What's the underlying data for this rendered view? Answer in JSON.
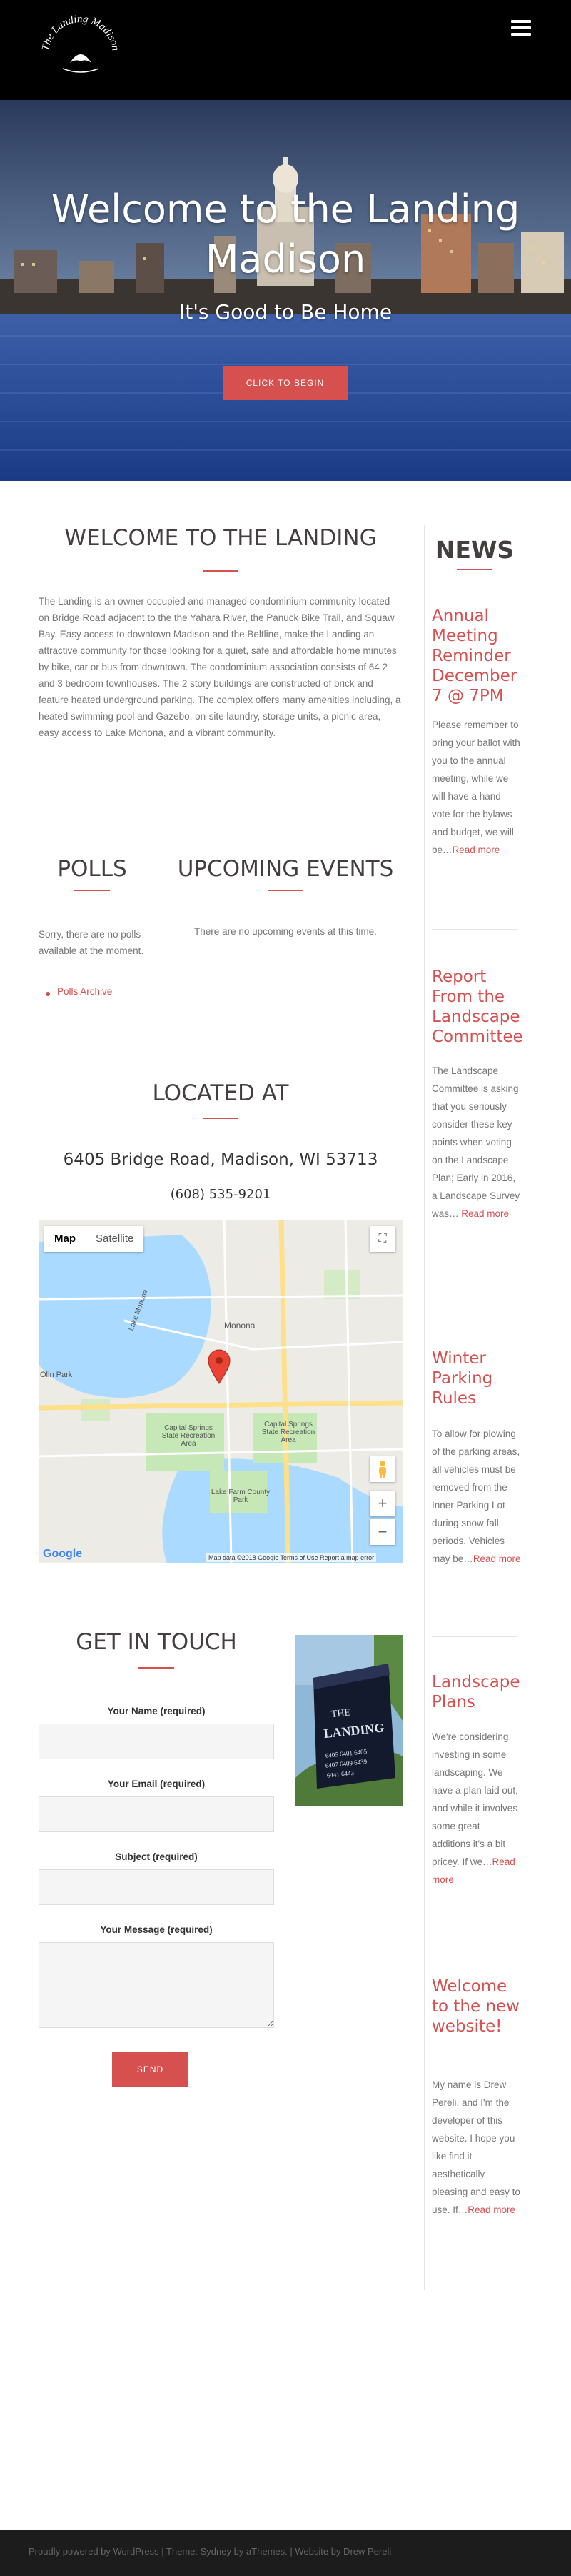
{
  "header": {
    "logo_text": "The Landing Madison",
    "menu_icon": "hamburger-menu-icon"
  },
  "hero": {
    "title": "Welcome to the Landing Madison",
    "subtitle": "It's Good to Be Home",
    "button_label": "CLICK TO BEGIN"
  },
  "welcome": {
    "title": "WELCOME TO THE LANDING",
    "body": "The Landing is an owner occupied and managed condominium community located on Bridge Road adjacent to the the Yahara River, the Panuck Bike Trail, and Squaw Bay. Easy access to downtown Madison and the Beltline, make the Landing an attractive community for those looking for a quiet, safe and affordable home minutes by bike, car or bus from downtown. The condominium association consists of 64 2 and 3 bedroom townhouses. The 2 story buildings are constructed of brick and feature heated underground parking. The complex offers many amenities including, a heated swimming pool and Gazebo, on-site laundry, storage units, a picnic area, easy access to Lake Monona, and a vibrant community."
  },
  "polls": {
    "title": "POLLS",
    "message": "Sorry, there are no polls available at the moment.",
    "archive_link": "Polls Archive"
  },
  "events": {
    "title": "UPCOMING EVENTS",
    "message": "There are no upcoming events at this time."
  },
  "location": {
    "title": "LOCATED AT",
    "address": "6405 Bridge Road, Madison, WI 53713",
    "phone": "(608) 535-9201"
  },
  "map": {
    "tab_map": "Map",
    "tab_satellite": "Satellite",
    "zoom_in": "+",
    "zoom_out": "−",
    "logo": "Google",
    "footer": "Map data ©2018 Google   Terms of Use   Report a map error",
    "labels": {
      "lake": "Lake Monona",
      "monona": "Monona",
      "park1": "Capital Springs State Recreation Area",
      "park2": "Capital Springs State Recreation Area",
      "park3": "Lake Farm County Park",
      "olin": "Olin Park"
    }
  },
  "contact": {
    "title": "GET IN TOUCH",
    "name_label": "Your Name (required)",
    "email_label": "Your Email (required)",
    "subject_label": "Subject (required)",
    "message_label": "Your Message (required)",
    "send_label": "SEND"
  },
  "sidebar": {
    "title": "NEWS",
    "posts": [
      {
        "title": "Annual Meeting Reminder December 7 @ 7PM",
        "excerpt": "Please remember to bring your ballot with you to the annual meeting, while we will have a hand vote for the bylaws and budget, we will be…",
        "more": "Read more"
      },
      {
        "title": "Report From the Landscape Committee",
        "excerpt": "The Landscape Committee is asking that you seriously consider these key points when voting on the Landscape Plan;  Early in 2016, a Landscape Survey was…",
        "more": "Read more"
      },
      {
        "title": "Winter Parking Rules",
        "excerpt": "To allow for plowing of the parking areas, all vehicles must be removed from the Inner Parking Lot during snow fall periods. Vehicles may be…",
        "more": "Read more"
      },
      {
        "title": "Landscape Plans",
        "excerpt": "We're considering investing in some landscaping. We have a plan laid out, and while it involves some great additions it's a bit pricey. If we…",
        "more": "Read more"
      },
      {
        "title": "Welcome to the new website!",
        "excerpt": "My name is Drew Pereli, and I'm the developer of this website. I hope you like find it aesthetically pleasing and easy to use. If…",
        "more": "Read more"
      }
    ]
  },
  "footer": {
    "text_wp": "Proudly powered by WordPress",
    "sep1": " | ",
    "text_theme": "Theme: Sydney by aThemes.",
    "sep2": " | ",
    "text_site": "Website by Drew Pereli"
  },
  "colors": {
    "accent": "#d65050",
    "header_bg": "#000000",
    "footer_bg": "#1c1c1c"
  }
}
